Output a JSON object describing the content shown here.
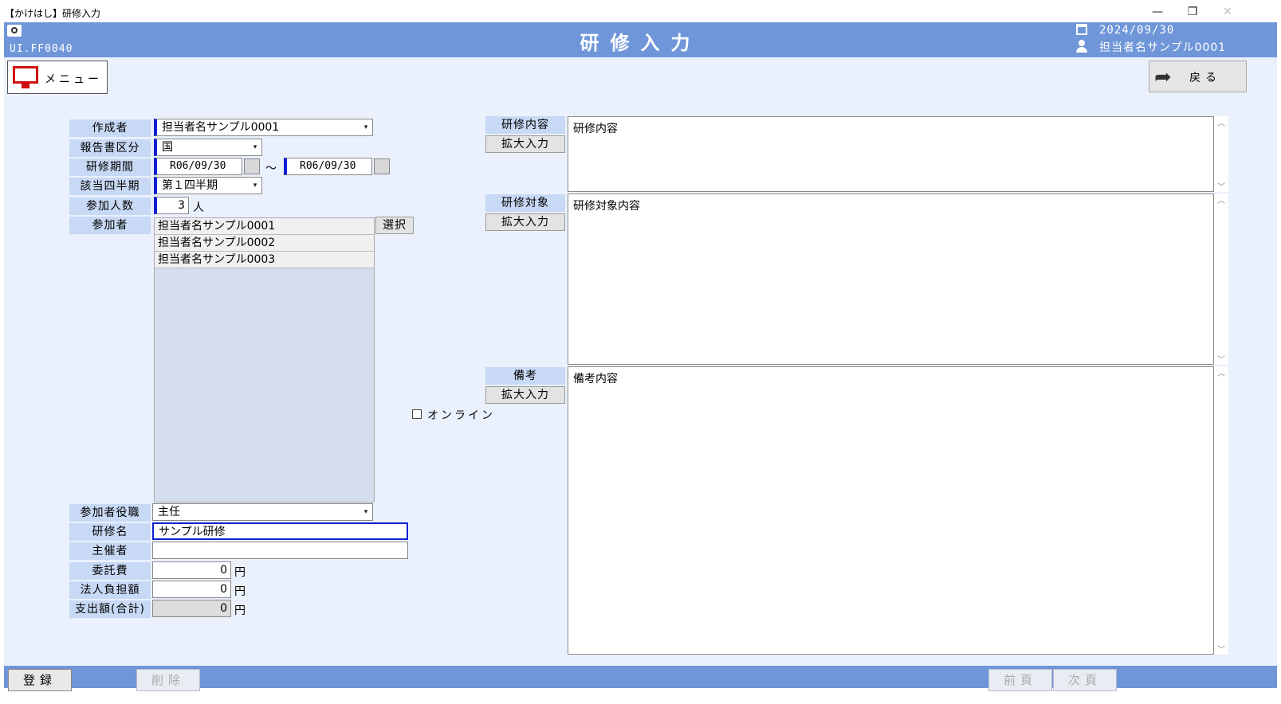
{
  "window": {
    "title": "【かけはし】研修入力",
    "minimize": "—",
    "restore": "❐",
    "close": "✕"
  },
  "header": {
    "screen_id": "UI.FF0040",
    "title": "研修入力",
    "date": "2024/09/30",
    "user": "担当者名サンプル0001"
  },
  "toolbar": {
    "menu_label": "メニュー",
    "back_label": "戻る"
  },
  "form": {
    "author": {
      "label": "作成者",
      "value": "担当者名サンプル0001"
    },
    "report_type": {
      "label": "報告書区分",
      "value": "国"
    },
    "period": {
      "label": "研修期間",
      "start": "R06/09/30",
      "separator": "～",
      "end": "R06/09/30"
    },
    "quarter": {
      "label": "該当四半期",
      "value": "第１四半期"
    },
    "attendee_count": {
      "label": "参加人数",
      "value": "3",
      "unit": "人"
    },
    "participants": {
      "label": "参加者",
      "select_button": "選択",
      "items": [
        "担当者名サンプル0001",
        "担当者名サンプル0002",
        "担当者名サンプル0003"
      ]
    },
    "participant_role": {
      "label": "参加者役職",
      "value": "主任"
    },
    "training_name": {
      "label": "研修名",
      "value": "サンプル研修"
    },
    "organizer": {
      "label": "主催者",
      "value": ""
    },
    "commission_fee": {
      "label": "委託費",
      "value": "0",
      "unit": "円"
    },
    "corporate_burden": {
      "label": "法人負担額",
      "value": "0",
      "unit": "円"
    },
    "total_expense": {
      "label": "支出額(合計)",
      "value": "0",
      "unit": "円"
    },
    "online": {
      "label": "オンライン",
      "checked": false
    },
    "content": {
      "label": "研修内容",
      "expand": "拡大入力",
      "value": "研修内容"
    },
    "target": {
      "label": "研修対象",
      "expand": "拡大入力",
      "value": "研修対象内容"
    },
    "remarks": {
      "label": "備考",
      "expand": "拡大入力",
      "value": "備考内容"
    }
  },
  "footer": {
    "register": "登録",
    "delete": "削除",
    "prev_page": "前頁",
    "next_page": "次頁"
  },
  "colors": {
    "header_blue": "#6f96d8",
    "label_bg": "#c8d9f5",
    "content_bg": "#eaf1fc",
    "focus_border": "#1020d0"
  }
}
